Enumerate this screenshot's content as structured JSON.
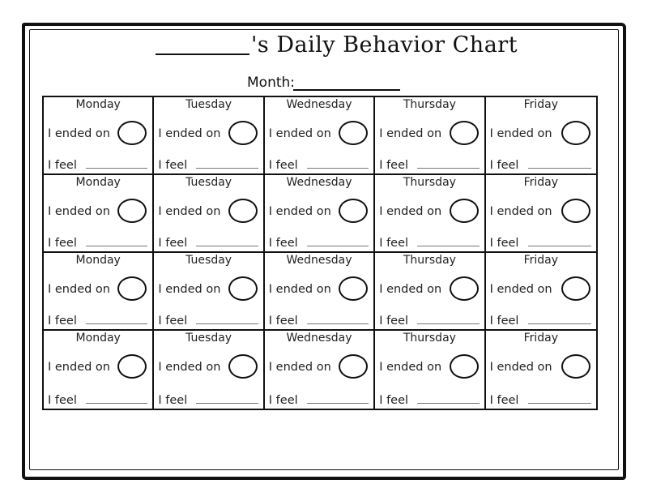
{
  "header": {
    "title": "'s Daily Behavior Chart",
    "name_blank": "",
    "month_label": "Month:",
    "month_value": ""
  },
  "cell_labels": {
    "ended_on": "I ended on",
    "feel": "I feel"
  },
  "weeks": [
    {
      "days": [
        "Monday",
        "Tuesday",
        "Wednesday",
        "Thursday",
        "Friday"
      ]
    },
    {
      "days": [
        "Monday",
        "Tuesday",
        "Wednesday",
        "Thursday",
        "Friday"
      ]
    },
    {
      "days": [
        "Monday",
        "Tuesday",
        "Wednesday",
        "Thursday",
        "Friday"
      ]
    },
    {
      "days": [
        "Monday",
        "Tuesday",
        "Wednesday",
        "Thursday",
        "Friday"
      ]
    }
  ]
}
